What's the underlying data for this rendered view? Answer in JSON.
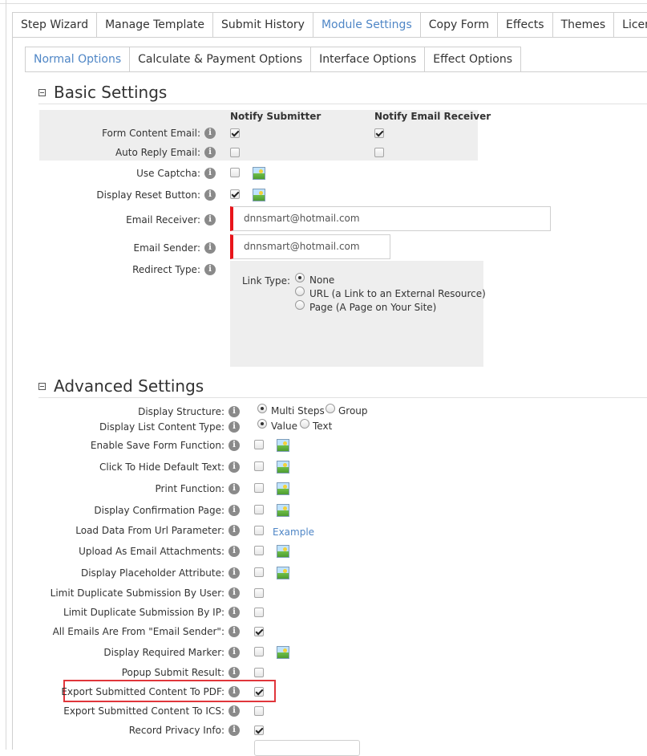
{
  "top_tabs": [
    {
      "label": "Step Wizard"
    },
    {
      "label": "Manage Template"
    },
    {
      "label": "Submit History"
    },
    {
      "label": "Module Settings",
      "active": true
    },
    {
      "label": "Copy Form"
    },
    {
      "label": "Effects"
    },
    {
      "label": "Themes"
    },
    {
      "label": "License"
    }
  ],
  "sub_tabs": [
    {
      "label": "Normal Options",
      "active": true
    },
    {
      "label": "Calculate & Payment Options"
    },
    {
      "label": "Interface Options"
    },
    {
      "label": "Effect Options"
    }
  ],
  "basic": {
    "title": "Basic Settings",
    "col_notify_submitter": "Notify Submitter",
    "col_notify_receiver": "Notify Email Receiver",
    "form_content_email": "Form Content Email:",
    "auto_reply_email": "Auto Reply Email:",
    "use_captcha": "Use Captcha:",
    "display_reset_button": "Display Reset Button:",
    "email_receiver": "Email Receiver:",
    "email_receiver_value": "dnnsmart@hotmail.com",
    "email_sender": "Email Sender:",
    "email_sender_value": "dnnsmart@hotmail.com",
    "redirect_type": "Redirect Type:",
    "link_type": "Link Type:",
    "link_none": "None",
    "link_url": "URL (a Link to an External Resource)",
    "link_page": "Page (A Page on Your Site)"
  },
  "advanced": {
    "title": "Advanced Settings",
    "display_structure": "Display Structure:",
    "multi_steps": "Multi Steps",
    "group": "Group",
    "display_list_content_type": "Display List Content Type:",
    "value": "Value",
    "text": "Text",
    "enable_save_form": "Enable Save Form Function:",
    "click_hide_default": "Click To Hide Default Text:",
    "print_function": "Print Function:",
    "display_confirmation": "Display Confirmation Page:",
    "load_data_url": "Load Data From Url Parameter:",
    "example_link": "Example",
    "upload_attachments": "Upload As Email Attachments:",
    "display_placeholder": "Display Placeholder Attribute:",
    "limit_dup_user": "Limit Duplicate Submission By User:",
    "limit_dup_ip": "Limit Duplicate Submission By IP:",
    "all_emails_sender": "All Emails Are From \"Email Sender\":",
    "display_required_marker": "Display Required Marker:",
    "popup_submit_result": "Popup Submit Result:",
    "export_pdf": "Export Submitted Content To PDF:",
    "export_ics": "Export Submitted Content To ICS:",
    "record_privacy": "Record Privacy Info:"
  },
  "info_glyph": "i",
  "colors": {
    "accent": "#4f86c6",
    "required": "#e8151b",
    "highlight": "#e0363b"
  }
}
